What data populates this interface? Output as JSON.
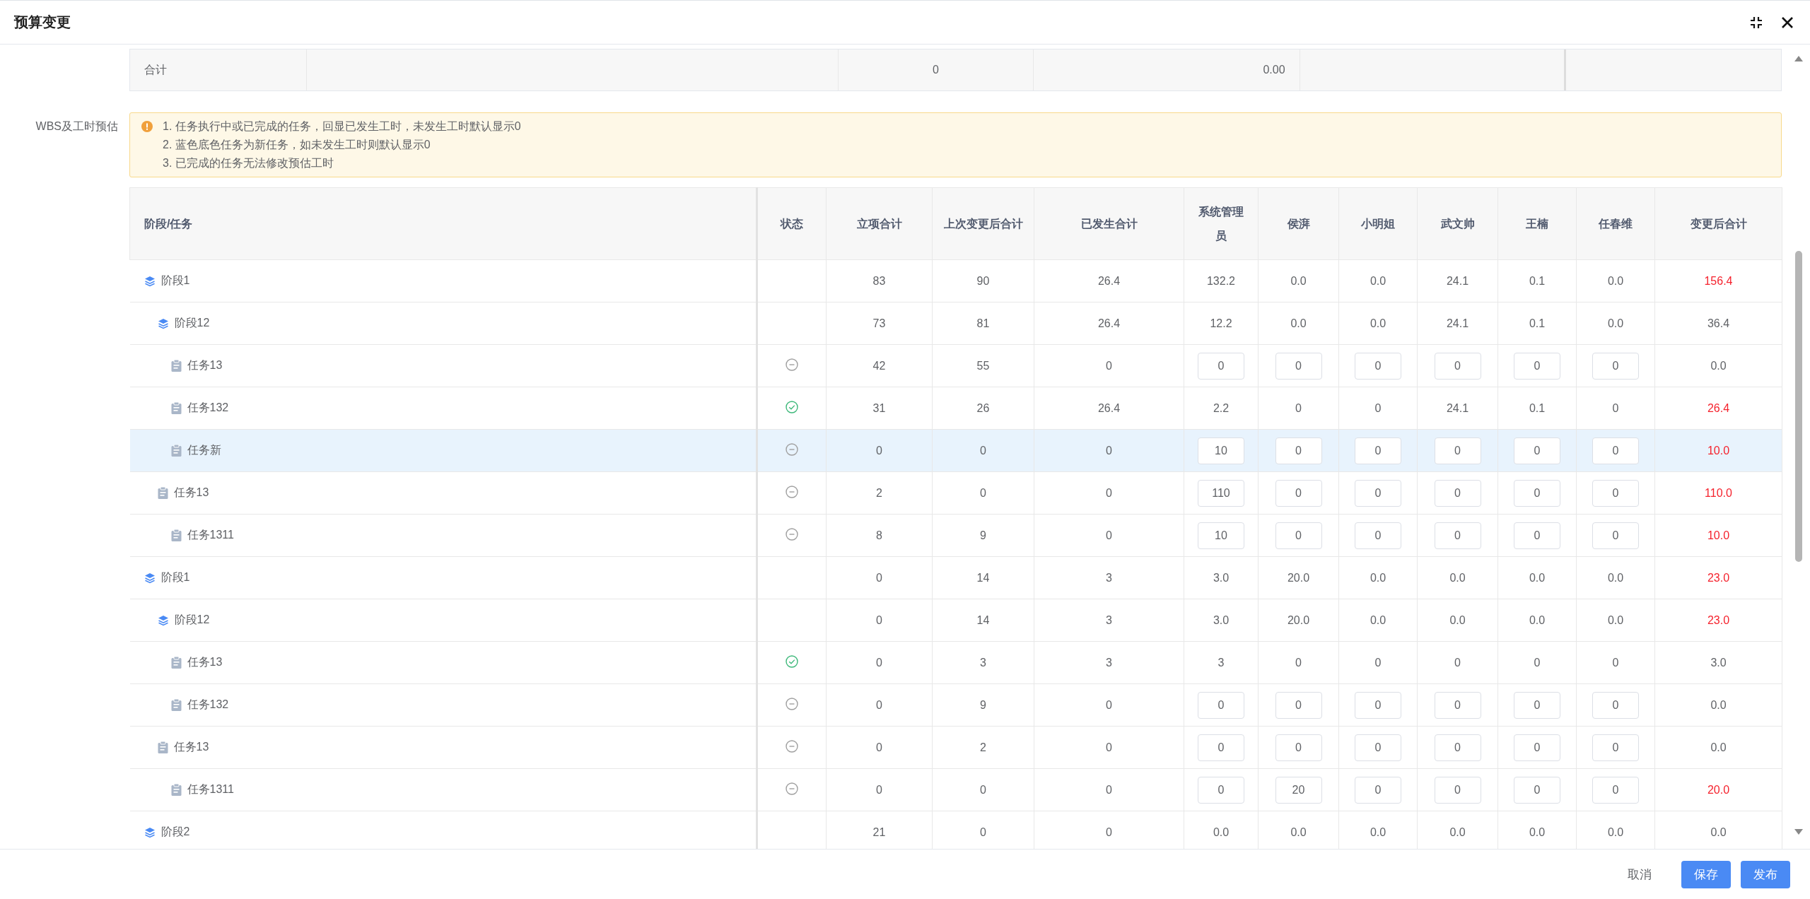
{
  "dialog": {
    "title": "预算变更"
  },
  "summary": {
    "label": "合计",
    "column_3": "0",
    "column_4": "0.00"
  },
  "wbs": {
    "label": "WBS及工时预估",
    "notes": [
      "1. 任务执行中或已完成的任务，回显已发生工时，未发生工时默认显示0",
      "2. 蓝色底色任务为新任务，如未发生工时则默认显示0",
      "3. 已完成的任务无法修改预估工时"
    ],
    "columns": [
      "阶段/任务",
      "状态",
      "立项合计",
      "上次变更后合计",
      "已发生合计",
      "系统管理员",
      "侯湃",
      "小明姐",
      "武文帅",
      "王楠",
      "任春维",
      "变更后合计"
    ],
    "rows": [
      {
        "kind": "stage",
        "name": "阶段1",
        "new": false,
        "editable": false,
        "budget": "83",
        "last": "90",
        "occurred": "26.4",
        "people": [
          "132.2",
          "0.0",
          "0.0",
          "24.1",
          "0.1",
          "0.0"
        ],
        "total": "156.4",
        "changed": true,
        "children": [
          {
            "kind": "stage",
            "name": "阶段12",
            "new": false,
            "editable": false,
            "budget": "73",
            "last": "81",
            "occurred": "26.4",
            "people": [
              "12.2",
              "0.0",
              "0.0",
              "24.1",
              "0.1",
              "0.0"
            ],
            "total": "36.4",
            "changed": false,
            "children": [
              {
                "kind": "task",
                "name": "任务13",
                "completed": false,
                "new": false,
                "editable": true,
                "budget": "42",
                "last": "55",
                "occurred": "0",
                "people": [
                  "0",
                  "0",
                  "0",
                  "0",
                  "0",
                  "0"
                ],
                "total": "0.0",
                "changed": false
              },
              {
                "kind": "task",
                "name": "任务132",
                "completed": true,
                "new": false,
                "editable": false,
                "budget": "31",
                "last": "26",
                "occurred": "26.4",
                "people": [
                  "2.2",
                  "0",
                  "0",
                  "24.1",
                  "0.1",
                  "0"
                ],
                "total": "26.4",
                "changed": true
              },
              {
                "kind": "task",
                "name": "任务新",
                "completed": false,
                "new": true,
                "editable": true,
                "budget": "0",
                "last": "0",
                "occurred": "0",
                "people": [
                  "10",
                  "0",
                  "0",
                  "0",
                  "0",
                  "0"
                ],
                "total": "10.0",
                "changed": true
              }
            ]
          },
          {
            "kind": "task",
            "name": "任务13",
            "completed": false,
            "new": false,
            "editable": true,
            "budget": "2",
            "last": "0",
            "occurred": "0",
            "people": [
              "110",
              "0",
              "0",
              "0",
              "0",
              "0"
            ],
            "total": "110.0",
            "changed": true,
            "children": [
              {
                "kind": "task",
                "name": "任务1311",
                "completed": false,
                "new": false,
                "editable": true,
                "budget": "8",
                "last": "9",
                "occurred": "0",
                "people": [
                  "10",
                  "0",
                  "0",
                  "0",
                  "0",
                  "0"
                ],
                "total": "10.0",
                "changed": true
              }
            ]
          }
        ]
      },
      {
        "kind": "stage",
        "name": "阶段1",
        "new": false,
        "editable": false,
        "budget": "0",
        "last": "14",
        "occurred": "3",
        "people": [
          "3.0",
          "20.0",
          "0.0",
          "0.0",
          "0.0",
          "0.0"
        ],
        "total": "23.0",
        "changed": true,
        "children": [
          {
            "kind": "stage",
            "name": "阶段12",
            "new": false,
            "editable": false,
            "budget": "0",
            "last": "14",
            "occurred": "3",
            "people": [
              "3.0",
              "20.0",
              "0.0",
              "0.0",
              "0.0",
              "0.0"
            ],
            "total": "23.0",
            "changed": true,
            "children": [
              {
                "kind": "task",
                "name": "任务13",
                "completed": true,
                "new": false,
                "editable": false,
                "budget": "0",
                "last": "3",
                "occurred": "3",
                "people": [
                  "3",
                  "0",
                  "0",
                  "0",
                  "0",
                  "0"
                ],
                "total": "3.0",
                "changed": false
              },
              {
                "kind": "task",
                "name": "任务132",
                "completed": false,
                "new": false,
                "editable": true,
                "budget": "0",
                "last": "9",
                "occurred": "0",
                "people": [
                  "0",
                  "0",
                  "0",
                  "0",
                  "0",
                  "0"
                ],
                "total": "0.0",
                "changed": false
              }
            ]
          },
          {
            "kind": "task",
            "name": "任务13",
            "completed": false,
            "new": false,
            "editable": true,
            "budget": "0",
            "last": "2",
            "occurred": "0",
            "people": [
              "0",
              "0",
              "0",
              "0",
              "0",
              "0"
            ],
            "total": "0.0",
            "changed": false,
            "children": [
              {
                "kind": "task",
                "name": "任务1311",
                "completed": false,
                "new": false,
                "editable": true,
                "budget": "0",
                "last": "0",
                "occurred": "0",
                "people": [
                  "0",
                  "20",
                  "0",
                  "0",
                  "0",
                  "0"
                ],
                "total": "20.0",
                "changed": true
              }
            ]
          }
        ]
      },
      {
        "kind": "stage",
        "name": "阶段2",
        "new": false,
        "editable": false,
        "budget": "21",
        "last": "0",
        "occurred": "0",
        "people": [
          "0.0",
          "0.0",
          "0.0",
          "0.0",
          "0.0",
          "0.0"
        ],
        "total": "0.0",
        "changed": false
      }
    ]
  },
  "footer": {
    "buttons": [
      {
        "label": "取消",
        "kind": "text"
      },
      {
        "label": "保存",
        "kind": "primary"
      },
      {
        "label": "发布",
        "kind": "primary"
      }
    ]
  }
}
